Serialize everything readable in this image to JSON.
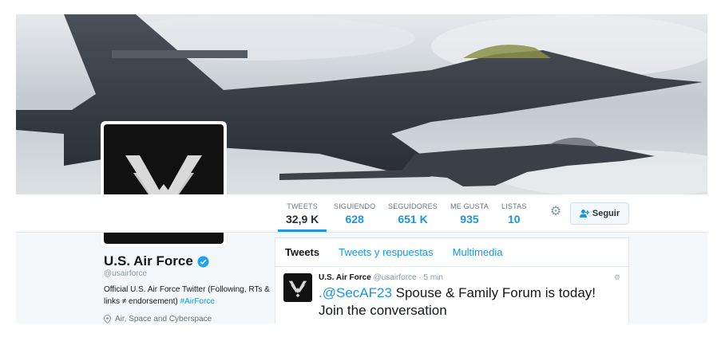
{
  "profile": {
    "name": "U.S. Air Force",
    "handle": "@usairforce",
    "bio_text": "Official U.S. Air Force Twitter (Following, RTs & links ≠ endorsement) ",
    "bio_hashtag": "#AirForce",
    "location": "Air, Space and Cyberspace",
    "verified_icon": "verified-badge-icon",
    "avatar_icon": "air-force-symbol-icon"
  },
  "stats": [
    {
      "label": "TWEETS",
      "value": "32,9 K"
    },
    {
      "label": "SIGUIENDO",
      "value": "628"
    },
    {
      "label": "SEGUIDORES",
      "value": "651 K"
    },
    {
      "label": "ME GUSTA",
      "value": "935"
    },
    {
      "label": "LISTAS",
      "value": "10"
    }
  ],
  "actions": {
    "follow_label": "Seguir",
    "follow_icon": "add-user-icon",
    "settings_icon": "gear-icon"
  },
  "tabs": [
    "Tweets",
    "Tweets y respuestas",
    "Multimedia"
  ],
  "tweet": {
    "name": "U.S. Air Force",
    "meta": "@usairforce · 5 min",
    "mention": ".@SecAF23",
    "text": " Spouse & Family Forum is today! Join the conversation"
  },
  "colors": {
    "accent": "#1b95e0",
    "text": "#14171a",
    "muted": "#8899a6"
  }
}
